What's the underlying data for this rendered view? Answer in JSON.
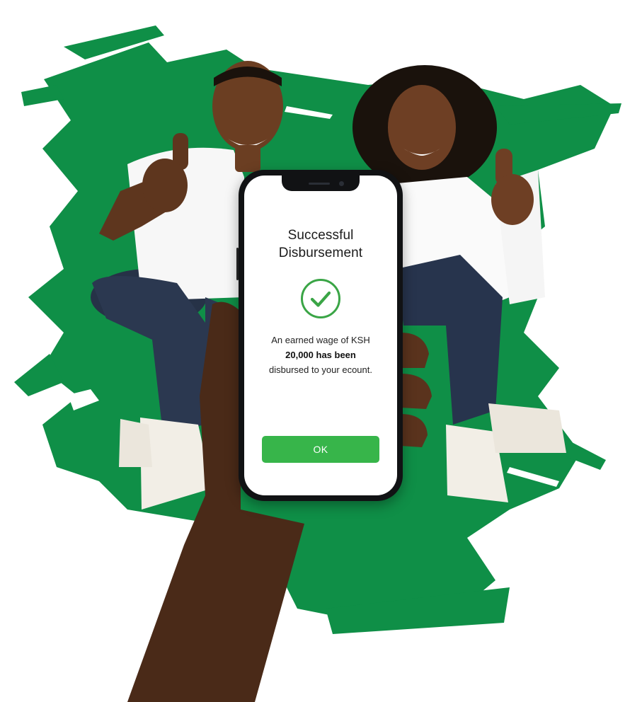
{
  "screen": {
    "title_line1": "Successful",
    "title_line2": "Disbursement",
    "message_line1": "An earned wage of KSH",
    "message_line2": "20,000 has been",
    "message_line3": "disbursed to your ecount.",
    "ok_button_label": "OK"
  },
  "colors": {
    "brush_green": "#0f8f47",
    "button_green": "#37b54a",
    "check_green": "#3aa546"
  },
  "icons": {
    "status": "check-circle-icon"
  }
}
